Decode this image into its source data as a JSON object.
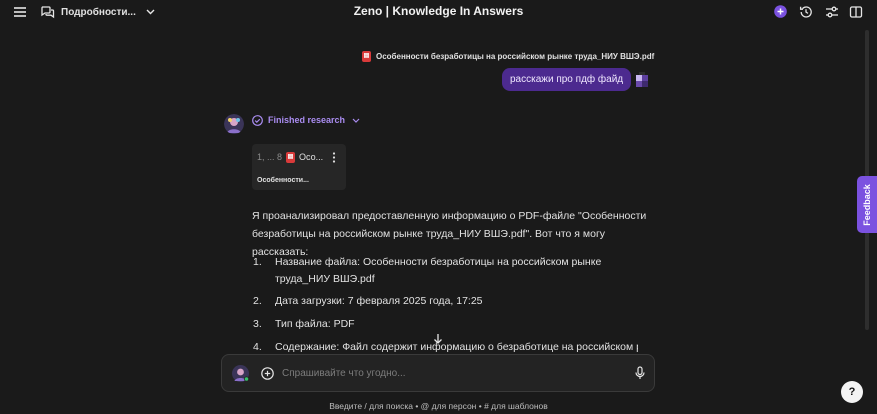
{
  "header": {
    "chat_selector_label": "Подробности...",
    "title": "Zeno | Knowledge In Answers"
  },
  "attachment": {
    "filename": "Особенности безработицы на российском рынке труда_НИУ ВШЭ.pdf",
    "icon": "pdf-icon"
  },
  "user_message": "расскажи про пдф файд",
  "research": {
    "label": "Finished research"
  },
  "source_card": {
    "pages": "1, ... 8",
    "name_short": "Осо...",
    "title": "Особенности..."
  },
  "answer": {
    "intro": "Я проанализировал предоставленную информацию о PDF-файле \"Особенности безработицы на российском рынке труда_НИУ ВШЭ.pdf\". Вот что я могу рассказать:",
    "items": [
      "Название файла: Особенности безработицы на российском рынке труда_НИУ ВШЭ.pdf",
      "Дата загрузки: 7 февраля 2025 года, 17:25",
      "Тип файла: PDF",
      "Содержание: Файл содержит информацию о безработице на российском рынке"
    ]
  },
  "composer": {
    "placeholder": "Спрашивайте что угодно..."
  },
  "hint": "Введите / для поиска  • @ для персон  • # для шаблонов",
  "feedback_label": "Feedback",
  "help_label": "?",
  "colors": {
    "accent": "#7b52e0",
    "user_bubble": "#4c2a8f",
    "research_text": "#a98cf0",
    "background": "#1a1a1a"
  }
}
